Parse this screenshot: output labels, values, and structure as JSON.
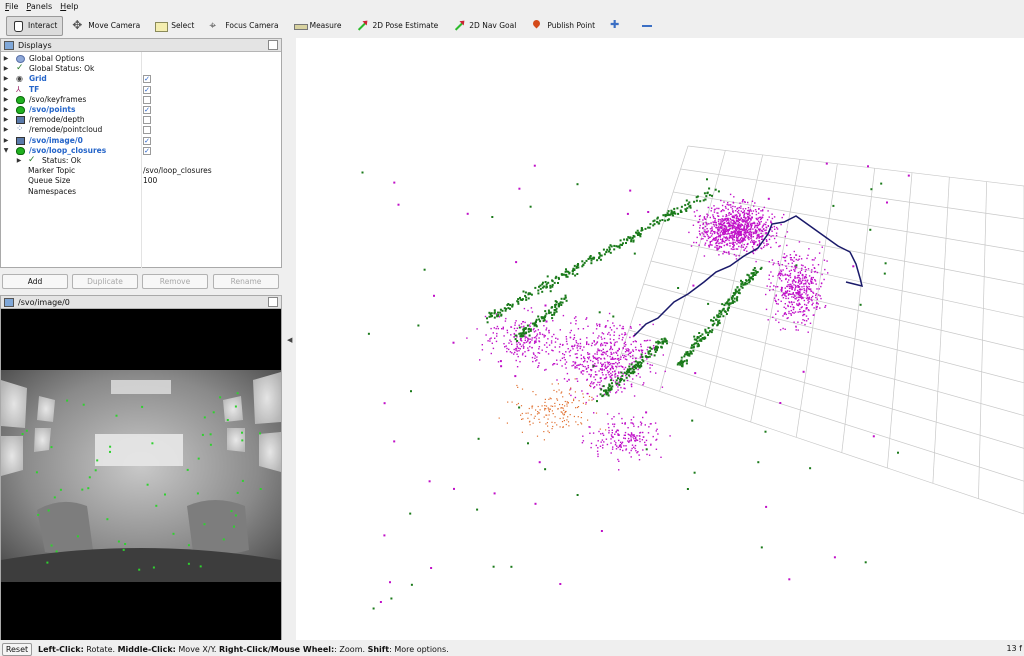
{
  "menu": [
    "File",
    "Panels",
    "Help"
  ],
  "toolbar": [
    {
      "label": "Interact",
      "icon": "hand-icon",
      "active": true
    },
    {
      "label": "Move Camera",
      "icon": "move-camera-icon"
    },
    {
      "label": "Select",
      "icon": "select-icon"
    },
    {
      "label": "Focus Camera",
      "icon": "focus-camera-icon"
    },
    {
      "label": "Measure",
      "icon": "measure-icon"
    },
    {
      "label": "2D Pose Estimate",
      "icon": "pose-arrow-icon"
    },
    {
      "label": "2D Nav Goal",
      "icon": "nav-arrow-icon"
    },
    {
      "label": "Publish Point",
      "icon": "map-pin-icon"
    }
  ],
  "displays": {
    "title": "Displays",
    "rows": [
      {
        "label": "Global Options",
        "icon": "globe-icon",
        "checked": null
      },
      {
        "label": "Global Status: Ok",
        "icon": "check-icon",
        "checked": null
      },
      {
        "label": "Grid",
        "icon": "eye-icon",
        "checked": true,
        "active": true
      },
      {
        "label": "TF",
        "icon": "tf-icon",
        "checked": true,
        "active": true
      },
      {
        "label": "/svo/keyframes",
        "icon": "marker-icon",
        "checked": false
      },
      {
        "label": "/svo/points",
        "icon": "marker-icon",
        "checked": true,
        "active": true
      },
      {
        "label": "/remode/depth",
        "icon": "monitor-icon",
        "checked": false
      },
      {
        "label": "/remode/pointcloud",
        "icon": "pointcloud-icon",
        "checked": false
      },
      {
        "label": "/svo/image/0",
        "icon": "monitor-icon",
        "checked": true,
        "active": true
      },
      {
        "label": "/svo/loop_closures",
        "icon": "marker-icon",
        "checked": true,
        "active": true,
        "expanded": true
      }
    ],
    "children": [
      {
        "label": "Status: Ok",
        "icon": "check-icon",
        "value": ""
      },
      {
        "label": "Marker Topic",
        "value": "/svo/loop_closures"
      },
      {
        "label": "Queue Size",
        "value": "100"
      },
      {
        "label": "Namespaces",
        "value": ""
      }
    ],
    "buttons": {
      "add": "Add",
      "duplicate": "Duplicate",
      "remove": "Remove",
      "rename": "Rename"
    }
  },
  "image_panel": {
    "title": "/svo/image/0"
  },
  "status": {
    "reset": "Reset",
    "parts": [
      {
        "bold": "Left-Click:",
        "text": " Rotate. "
      },
      {
        "bold": "Middle-Click:",
        "text": " Move X/Y. "
      },
      {
        "bold": "Right-Click/Mouse Wheel:",
        "text": ": Zoom. "
      },
      {
        "bold": "Shift",
        "text": ": More options."
      }
    ],
    "fps": "13 f"
  },
  "colors": {
    "accent_blue": "#2565c9",
    "points_magenta": "#c010c8",
    "points_green": "#1a7a1a",
    "trajectory": "#1a1a6a",
    "points_orange": "#e07030"
  }
}
